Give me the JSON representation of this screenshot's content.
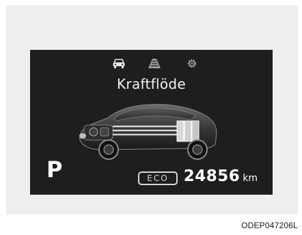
{
  "display": {
    "tabs": [
      {
        "icon": "car-icon"
      },
      {
        "icon": "road-icon"
      },
      {
        "icon": "settings-gear-icon"
      }
    ],
    "title": "Kraftflöde",
    "gear": "P",
    "drive_mode": "ECO",
    "odometer": {
      "value": "24856",
      "unit": "km"
    }
  },
  "figure_code": "ODEP047206L"
}
